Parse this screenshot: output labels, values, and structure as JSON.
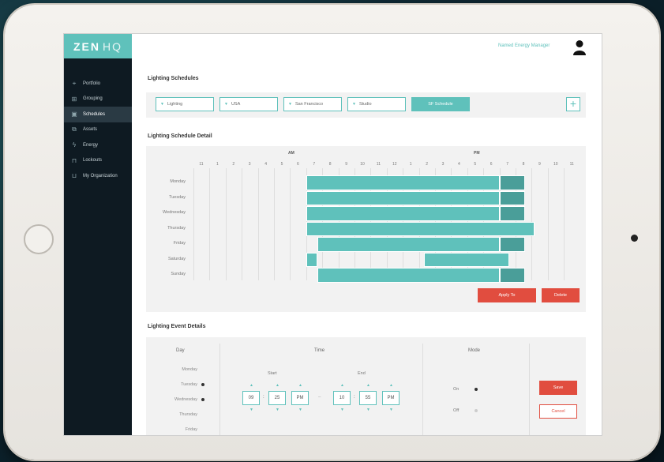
{
  "app": {
    "logo_main": "ZEN",
    "logo_sub": "HQ"
  },
  "user": {
    "name": "Named Energy Manager"
  },
  "sidebar": {
    "items": [
      {
        "label": "Portfolio",
        "icon": "map-pin-icon",
        "active": false
      },
      {
        "label": "Grouping",
        "icon": "grouping-icon",
        "active": false
      },
      {
        "label": "Schedules",
        "icon": "calendar-icon",
        "active": true
      },
      {
        "label": "Assets",
        "icon": "assets-icon",
        "active": false
      },
      {
        "label": "Energy",
        "icon": "energy-icon",
        "active": false
      },
      {
        "label": "Lockouts",
        "icon": "lock-icon",
        "active": false
      },
      {
        "label": "My Organization",
        "icon": "organization-icon",
        "active": false
      }
    ]
  },
  "schedules": {
    "title": "Lighting Schedules",
    "filters": [
      "Lighting",
      "USA",
      "San Francisco",
      "Studio"
    ],
    "primary_button": "SF Schedule",
    "add_button": "+"
  },
  "detail": {
    "title": "Lighting Schedule Detail",
    "am_label": "AM",
    "pm_label": "PM",
    "hours": [
      "11",
      "1",
      "2",
      "3",
      "4",
      "5",
      "6",
      "7",
      "8",
      "9",
      "10",
      "11",
      "12",
      "1",
      "2",
      "3",
      "4",
      "5",
      "6",
      "7",
      "8",
      "9",
      "10",
      "11"
    ],
    "days": [
      "Monday",
      "Tuesday",
      "Wednesday",
      "Thursday",
      "Friday",
      "Saturday",
      "Sunday"
    ],
    "bars": [
      {
        "day": 0,
        "start": 7,
        "end": 19,
        "tail_end": 20.6
      },
      {
        "day": 1,
        "start": 7,
        "end": 19,
        "tail_end": 20.6
      },
      {
        "day": 2,
        "start": 7,
        "end": 19,
        "tail_end": 20.6
      },
      {
        "day": 3,
        "start": 7,
        "end": 21.2,
        "tail_end": null
      },
      {
        "day": 4,
        "start": 7.7,
        "end": 19,
        "tail_end": 20.6
      },
      {
        "day": 5,
        "start": 7,
        "end": 7.7,
        "tail_end": null
      },
      {
        "day": 5,
        "start": 14.3,
        "end": 19.6,
        "tail_end": null
      },
      {
        "day": 6,
        "start": 7.7,
        "end": 19,
        "tail_end": 20.6
      }
    ],
    "apply_button": "Apply To",
    "delete_button": "Delete"
  },
  "event": {
    "title": "Lighting Event Details",
    "col_day": "Day",
    "col_time": "Time",
    "col_mode": "Mode",
    "days": [
      {
        "label": "Monday",
        "selected": false
      },
      {
        "label": "Tuesday",
        "selected": true
      },
      {
        "label": "Wednesday",
        "selected": true
      },
      {
        "label": "Thursday",
        "selected": false
      },
      {
        "label": "Friday",
        "selected": false
      }
    ],
    "start_label": "Start",
    "end_label": "End",
    "start_hour": "09",
    "start_min": "25",
    "start_ampm": "PM",
    "end_hour": "10",
    "end_min": "55",
    "end_ampm": "PM",
    "mode_on": "On",
    "mode_off": "Off",
    "save_button": "Save",
    "cancel_button": "Cancel"
  },
  "colors": {
    "accent": "#5fc1bb",
    "danger": "#e14d3f",
    "sidebar": "#0e1a22"
  }
}
